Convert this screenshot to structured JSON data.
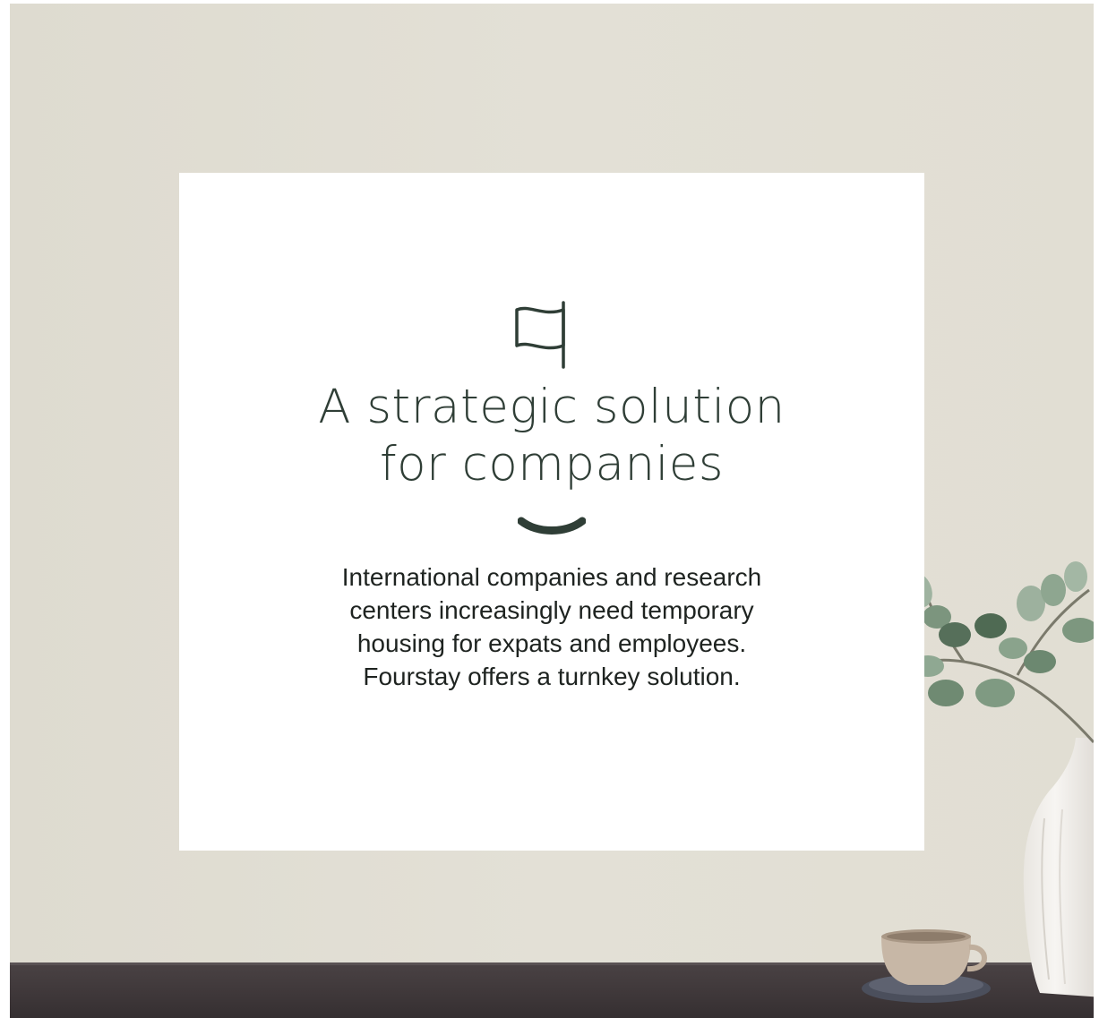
{
  "card": {
    "icon": "flag-icon",
    "title_line1": "A strategic solution",
    "title_line2": "for companies",
    "divider_icon": "smile-divider",
    "body": "International companies and research centers increasingly need temporary housing for expats and employees. Fourstay offers a turnkey solution."
  },
  "colors": {
    "background": "#e0ddd2",
    "card": "#ffffff",
    "accent_green": "#2f3e36",
    "text": "#1e2320",
    "desk": "#3e3739"
  }
}
